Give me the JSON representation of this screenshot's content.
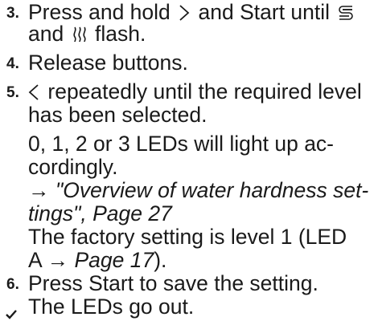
{
  "steps": {
    "s3": {
      "number": "3.",
      "text_a": "Press and hold",
      "text_b": "and Start until",
      "text_c": "and",
      "text_d": "flash.",
      "icon_1": "chevron-right-icon",
      "icon_2": "program-icon",
      "icon_3": "heat-icon"
    },
    "s4": {
      "number": "4.",
      "text": "Release buttons."
    },
    "s5": {
      "number": "5.",
      "text_a": "repeatedly until the required level",
      "line2": "has been selected.",
      "icon_1": "chevron-left-icon",
      "p1_line1": "0, 1, 2 or 3 LEDs will light up ac-",
      "p1_line2": "cordingly.",
      "ref_arrow": "→",
      "ref_line1": "\"Overview of water hardness set-",
      "ref_line2": "tings\", Page 27",
      "p2_line1": "The factory setting is level 1 (LED",
      "p2_line2_a": "A",
      "p2_line2_arrow": "→",
      "p2_line2_ref": "Page 17",
      "p2_line2_end": ")."
    },
    "s6": {
      "number": "6.",
      "text": "Press Start to save the setting."
    },
    "result": {
      "icon": "checkmark-icon",
      "text": "The LEDs go out."
    }
  }
}
